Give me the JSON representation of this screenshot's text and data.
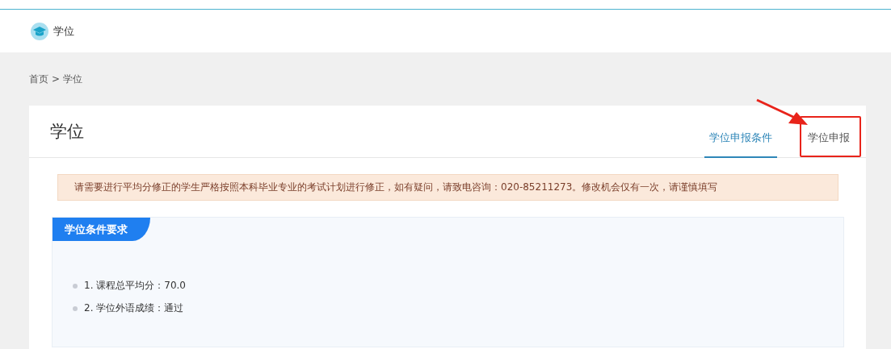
{
  "header": {
    "title": "学位"
  },
  "breadcrumb": {
    "items": [
      "首页",
      "学位"
    ],
    "separator": ">"
  },
  "card": {
    "title": "学位",
    "tabs": [
      {
        "label": "学位申报条件",
        "selected": true
      },
      {
        "label": "学位申报",
        "selected": false,
        "annotated": true
      }
    ],
    "notice": "请需要进行平均分修正的学生严格按照本科毕业专业的考试计划进行修正，如有疑问，请致电咨询：020-85211273。修改机会仅有一次，请谨慎填写",
    "section": {
      "title": "学位条件要求",
      "items": [
        "1. 课程总平均分：70.0",
        "2. 学位外语成绩：通过"
      ]
    }
  }
}
